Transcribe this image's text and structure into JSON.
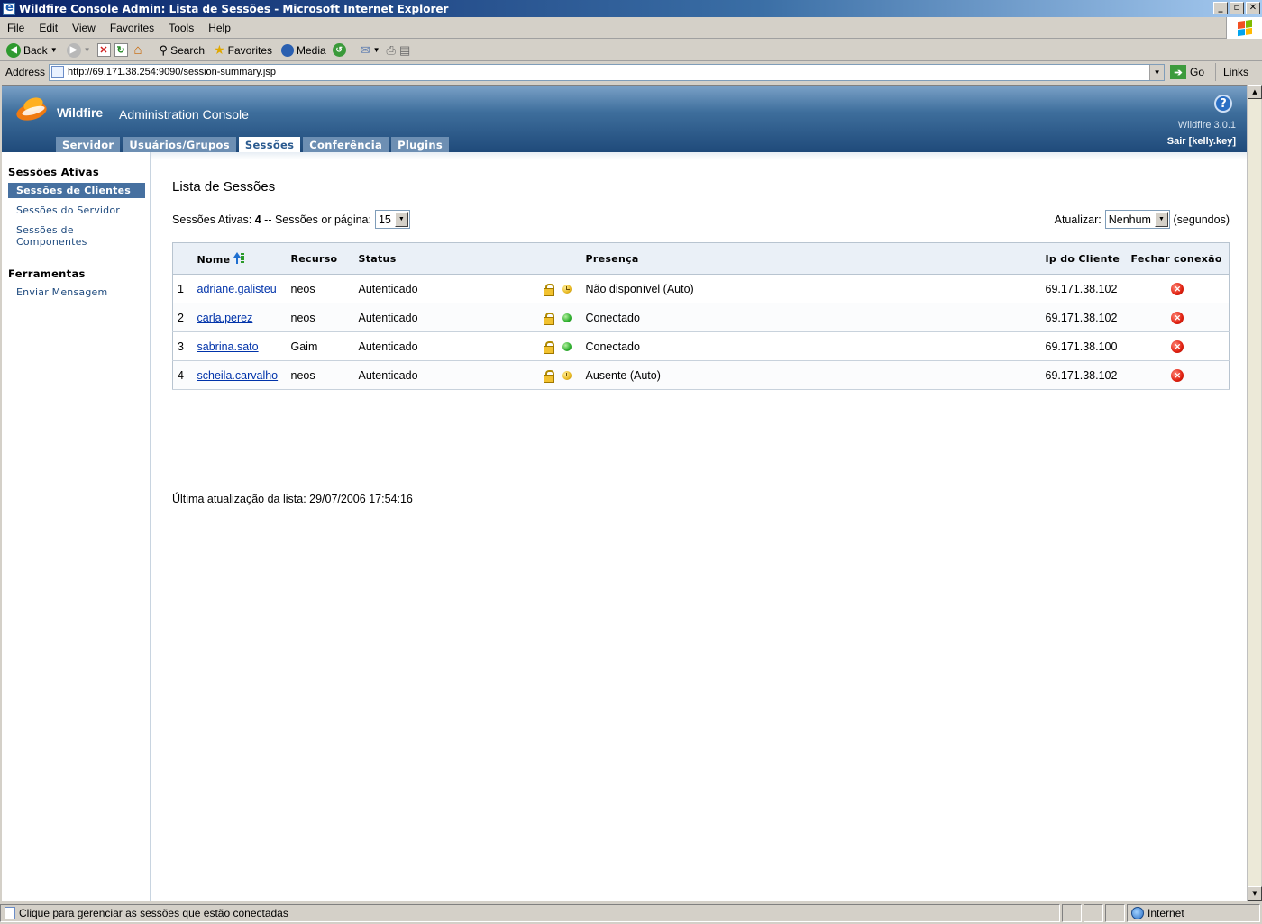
{
  "window": {
    "title": "Wildfire Console Admin: Lista de Sessões - Microsoft Internet Explorer",
    "minimize": "_",
    "restore": "▫",
    "close": "✕"
  },
  "menu": [
    "File",
    "Edit",
    "View",
    "Favorites",
    "Tools",
    "Help"
  ],
  "toolbar": {
    "back": "Back",
    "search": "Search",
    "favorites": "Favorites",
    "media": "Media"
  },
  "address": {
    "label": "Address",
    "url": "http://69.171.38.254:9090/session-summary.jsp",
    "go": "Go",
    "links": "Links"
  },
  "header": {
    "brand": "Wildfire",
    "console": "Administration Console",
    "version": "Wildfire 3.0.1",
    "logout": "Sair [kelly.key]",
    "help": "?",
    "tabs": [
      "Servidor",
      "Usuários/Grupos",
      "Sessões",
      "Conferência",
      "Plugins"
    ],
    "active_tab": "Sessões"
  },
  "sidebar": {
    "sections": [
      {
        "title": "Sessões Ativas",
        "items": [
          "Sessões de Clientes",
          "Sessões do Servidor",
          "Sessões de Componentes"
        ]
      },
      {
        "title": "Ferramentas",
        "items": [
          "Enviar Mensagem"
        ]
      }
    ],
    "sessoes_de_componentes_line1": "Sessões de",
    "sessoes_de_componentes_line2": "Componentes"
  },
  "main": {
    "title": "Lista de Sessões",
    "active_label": "Sessões Ativas:",
    "active_count": "4",
    "per_page_label": "-- Sessões or página:",
    "per_page_value": "15",
    "refresh_label": "Atualizar:",
    "refresh_value": "Nenhum",
    "refresh_unit": "(segundos)",
    "columns": [
      "Nome",
      "Recurso",
      "Status",
      "Presença",
      "Ip do Cliente",
      "Fechar conexão"
    ],
    "rows": [
      {
        "n": "1",
        "name": "adriane.galisteu",
        "resource": "neos",
        "status": "Autenticado",
        "presence": "Não disponível (Auto)",
        "presence_type": "away",
        "ip": "69.171.38.102"
      },
      {
        "n": "2",
        "name": "carla.perez",
        "resource": "neos",
        "status": "Autenticado",
        "presence": "Conectado",
        "presence_type": "online",
        "ip": "69.171.38.102"
      },
      {
        "n": "3",
        "name": "sabrina.sato",
        "resource": "Gaim",
        "status": "Autenticado",
        "presence": "Conectado",
        "presence_type": "online",
        "ip": "69.171.38.100"
      },
      {
        "n": "4",
        "name": "scheila.carvalho",
        "resource": "neos",
        "status": "Autenticado",
        "presence": "Ausente (Auto)",
        "presence_type": "away",
        "ip": "69.171.38.102"
      }
    ],
    "last_update": "Última atualização da lista: 29/07/2006 17:54:16"
  },
  "statusbar": {
    "message": "Clique para gerenciar as sessões que estão conectadas",
    "zone": "Internet"
  }
}
